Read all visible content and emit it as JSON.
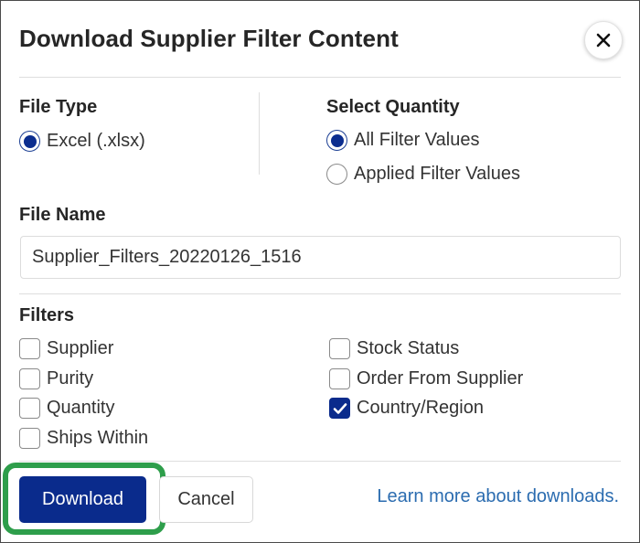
{
  "dialog": {
    "title": "Download Supplier Filter Content",
    "close_icon": "close-icon"
  },
  "file_type": {
    "label": "File Type",
    "options": [
      {
        "label": "Excel (.xlsx)",
        "checked": true
      }
    ]
  },
  "select_quantity": {
    "label": "Select Quantity",
    "options": [
      {
        "label": "All Filter Values",
        "checked": true
      },
      {
        "label": "Applied Filter Values",
        "checked": false
      }
    ]
  },
  "file_name": {
    "label": "File Name",
    "value": "Supplier_Filters_20220126_1516"
  },
  "filters": {
    "label": "Filters",
    "items": [
      {
        "label": "Supplier",
        "checked": false
      },
      {
        "label": "Purity",
        "checked": false
      },
      {
        "label": "Quantity",
        "checked": false
      },
      {
        "label": "Ships Within",
        "checked": false
      },
      {
        "label": "Stock Status",
        "checked": false
      },
      {
        "label": "Order From Supplier",
        "checked": false
      },
      {
        "label": "Country/Region",
        "checked": true
      }
    ]
  },
  "footer": {
    "download_label": "Download",
    "cancel_label": "Cancel",
    "learn_more_label": "Learn more about downloads."
  },
  "colors": {
    "primary": "#0a2b8c",
    "highlight": "#2e9e4b",
    "link": "#2b6cb0"
  }
}
